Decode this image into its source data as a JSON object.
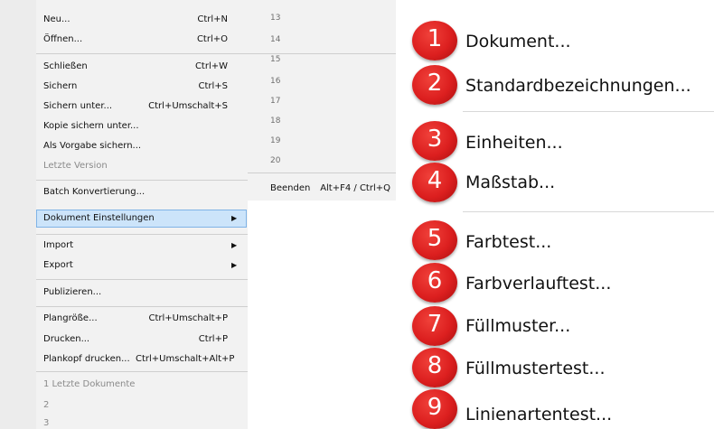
{
  "menu": {
    "items": [
      {
        "label": "Neu...",
        "shortcut": "Ctrl+N"
      },
      {
        "label": "Öffnen...",
        "shortcut": "Ctrl+O"
      },
      {
        "label": "Schließen",
        "shortcut": "Ctrl+W"
      },
      {
        "label": "Sichern",
        "shortcut": "Ctrl+S"
      },
      {
        "label": "Sichern unter...",
        "shortcut": "Ctrl+Umschalt+S"
      },
      {
        "label": "Kopie sichern unter...",
        "shortcut": ""
      },
      {
        "label": "Als Vorgabe sichern...",
        "shortcut": ""
      },
      {
        "label": "Letzte Version",
        "shortcut": ""
      },
      {
        "label": "Batch Konvertierung...",
        "shortcut": ""
      },
      {
        "label": "Dokument Einstellungen",
        "shortcut": ""
      },
      {
        "label": "Import",
        "shortcut": ""
      },
      {
        "label": "Export",
        "shortcut": ""
      },
      {
        "label": "Publizieren...",
        "shortcut": ""
      },
      {
        "label": "Plangröße...",
        "shortcut": "Ctrl+Umschalt+P"
      },
      {
        "label": "Drucken...",
        "shortcut": "Ctrl+P"
      },
      {
        "label": "Plankopf drucken...",
        "shortcut": "Ctrl+Umschalt+Alt+P"
      }
    ],
    "recent_header": "1 Letzte Dokumente",
    "recent": [
      "2",
      "3"
    ],
    "submenu_arrow": "▶",
    "numbers": [
      "13",
      "14",
      "15",
      "16",
      "17",
      "18",
      "19",
      "20"
    ],
    "quit_label": "Beenden",
    "quit_shortcut": "Alt+F4 / Ctrl+Q"
  },
  "submenu": {
    "items": [
      {
        "badge": "1",
        "label": "Dokument..."
      },
      {
        "badge": "2",
        "label": "Standardbezeichnungen..."
      },
      {
        "badge": "3",
        "label": "Einheiten..."
      },
      {
        "badge": "4",
        "label": "Maßstab..."
      },
      {
        "badge": "5",
        "label": "Farbtest..."
      },
      {
        "badge": "6",
        "label": "Farbverlauftest..."
      },
      {
        "badge": "7",
        "label": "Füllmuster..."
      },
      {
        "badge": "8",
        "label": "Füllmustertest..."
      },
      {
        "badge": "9",
        "label": "Linienartentest..."
      }
    ]
  },
  "colors": {
    "highlight": "#cce4fa",
    "badge": "#dc1f1f"
  }
}
